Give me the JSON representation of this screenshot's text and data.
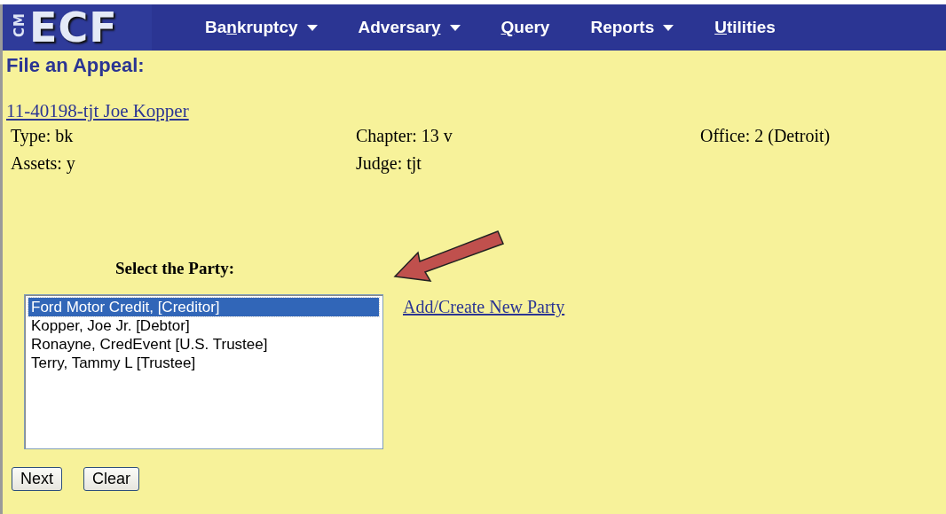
{
  "logo": {
    "prefix": "CM",
    "name": "ECF"
  },
  "menu": [
    {
      "before": "Ba",
      "key": "n",
      "after": "kruptcy",
      "dropdown": true
    },
    {
      "before": "Adversar",
      "key": "y",
      "dropdown": true
    },
    {
      "key": "Q",
      "after": "uery",
      "dropdown": false
    },
    {
      "before": "Reports",
      "dropdown": true
    },
    {
      "key": "U",
      "after": "tilities",
      "dropdown": false
    }
  ],
  "page_title": "File an Appeal:",
  "case_link": "11-40198-tjt Joe Kopper",
  "case_info": [
    [
      "Type: bk",
      "Chapter: 13 v",
      "Office: 2 (Detroit)"
    ],
    [
      "Assets: y",
      "Judge: tjt"
    ]
  ],
  "party_label": "Select the Party:",
  "parties": [
    {
      "label": "Ford Motor Credit, [Creditor]",
      "selected": true
    },
    {
      "label": "Kopper, Joe Jr. [Debtor]",
      "selected": false
    },
    {
      "label": "Ronayne, CredEvent [U.S. Trustee]",
      "selected": false
    },
    {
      "label": "Terry, Tammy L [Trustee]",
      "selected": false
    }
  ],
  "add_party_link": "Add/Create New Party",
  "buttons": [
    "Next",
    "Clear"
  ]
}
